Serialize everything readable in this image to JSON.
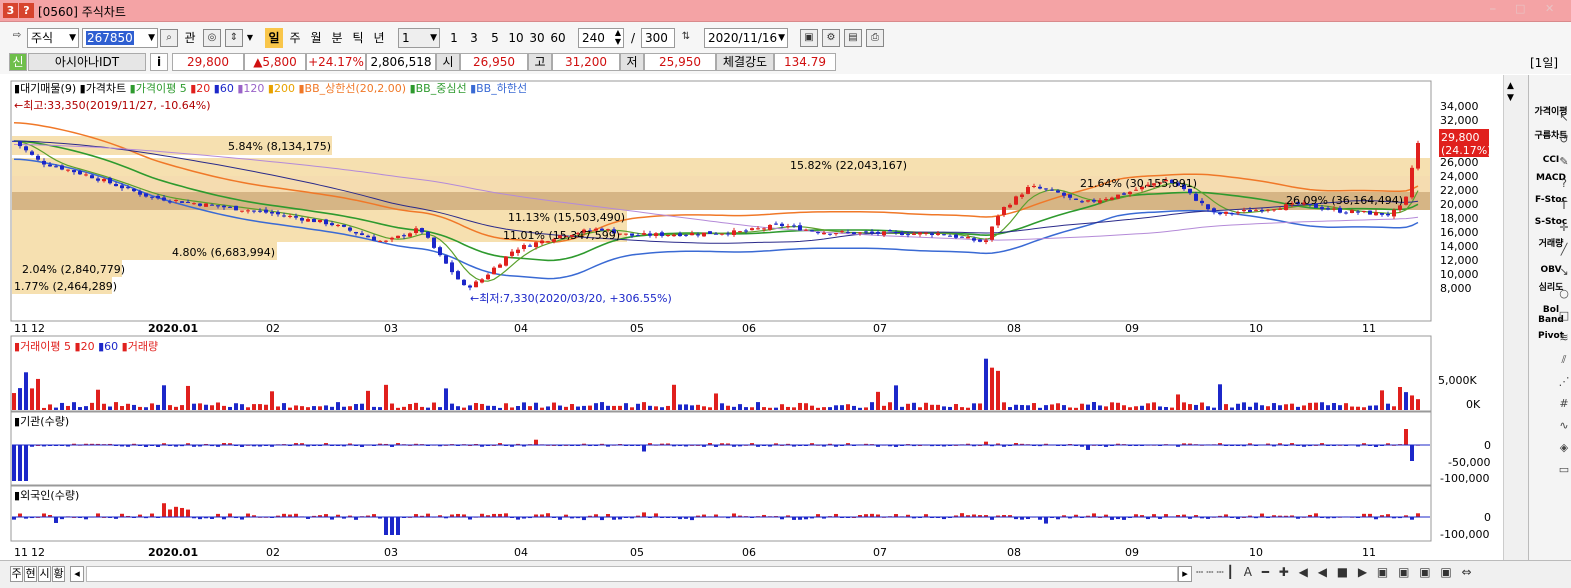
{
  "window": {
    "badge1": "3",
    "badge2": "?",
    "title": "[0560] 주식차트"
  },
  "toolbar": {
    "market": "주식",
    "code": "267850",
    "gwan": "관",
    "periods": [
      "일",
      "주",
      "월",
      "분",
      "틱",
      "년"
    ],
    "period_select": "1",
    "intervals": [
      "1",
      "3",
      "5",
      "10",
      "30",
      "60"
    ],
    "count_value": "240",
    "slash": "/",
    "total_value": "300",
    "date": "2020/11/16"
  },
  "info": {
    "badge": "신",
    "name": "아시아나IDT",
    "i": "i",
    "price": "29,800",
    "change": "▲5,800",
    "rate": "+24.17%",
    "volume": "2,806,518",
    "open_label": "시",
    "open": "26,950",
    "high_label": "고",
    "high": "31,200",
    "low_label": "저",
    "low": "25,950",
    "strength_label": "체결강도",
    "strength": "134.79",
    "period_tag": "[1일]"
  },
  "legend_main": [
    "대기매물(9)",
    "가격차트",
    "가격이평 5",
    "20",
    "60",
    "120",
    "200",
    "BB_상한선(20,2.00)",
    "BB_중심선",
    "BB_하한선"
  ],
  "annotations": {
    "high": "←최고:33,350(2019/11/27, -10.64%)",
    "low": "←최저:7,330(2020/03/20, +306.55%)",
    "price_tag": "29,800",
    "rate_tag": "(24.17%)"
  },
  "supply_labels": [
    "5.84% (8,134,175)",
    "15.82% (22,043,167)",
    "21.64% (30,155,891)",
    "26.09% (36,164,494)",
    "11.13% (15,503,490)",
    "11.01% (15,347,599)",
    "4.80% (6,683,994)",
    "2.04% (2,840,779)",
    "1.77% (2,464,289)"
  ],
  "price_axis": [
    "34,000",
    "32,000",
    "30,000",
    "28,000",
    "26,000",
    "24,000",
    "22,000",
    "20,000",
    "18,000",
    "16,000",
    "14,000",
    "12,000",
    "10,000",
    "8,000"
  ],
  "x_labels": [
    "11",
    "12",
    "2020.01",
    "02",
    "03",
    "04",
    "05",
    "06",
    "07",
    "08",
    "09",
    "10",
    "11"
  ],
  "volume_panel": {
    "legend": [
      "거래이평 5",
      "20",
      "60",
      "거래량"
    ],
    "axis": [
      "5,000K",
      "0K"
    ]
  },
  "inst_panel": {
    "legend": "기관(수량)",
    "axis": [
      "0",
      "-50,000",
      "-100,000"
    ]
  },
  "foreign_panel": {
    "legend": "외국인(수량)",
    "axis": [
      "0",
      "-100,000"
    ]
  },
  "rightbar": [
    "가격이평",
    "구름차트",
    "CCI",
    "MACD",
    "F-Stoc",
    "S-Stoc",
    "거래량",
    "OBV",
    "심리도",
    "Bol Band",
    "Pivot"
  ],
  "status": [
    "주",
    "현",
    "시",
    "황"
  ],
  "colors": {
    "up": "#e0201d",
    "down": "#1c27c9",
    "titlebar": "#f4a3a5",
    "ma5": "#2e9a2e",
    "bb_upper": "#f07828"
  },
  "chart_data": {
    "type": "candlestick",
    "series_monthly_approx": [
      {
        "month": "2019-11",
        "close": 28000
      },
      {
        "month": "2019-12",
        "close": 24000
      },
      {
        "month": "2020-01",
        "close": 20000
      },
      {
        "month": "2020-02",
        "close": 19000
      },
      {
        "month": "2020-03",
        "close": 9000
      },
      {
        "month": "2020-04",
        "close": 15500
      },
      {
        "month": "2020-05",
        "close": 15800
      },
      {
        "month": "2020-06",
        "close": 16500
      },
      {
        "month": "2020-07",
        "close": 15500
      },
      {
        "month": "2020-08",
        "close": 22000
      },
      {
        "month": "2020-09",
        "close": 23000
      },
      {
        "month": "2020-10",
        "close": 19500
      },
      {
        "month": "2020-11",
        "close": 29800
      }
    ],
    "ylim": [
      6000,
      35000
    ]
  }
}
